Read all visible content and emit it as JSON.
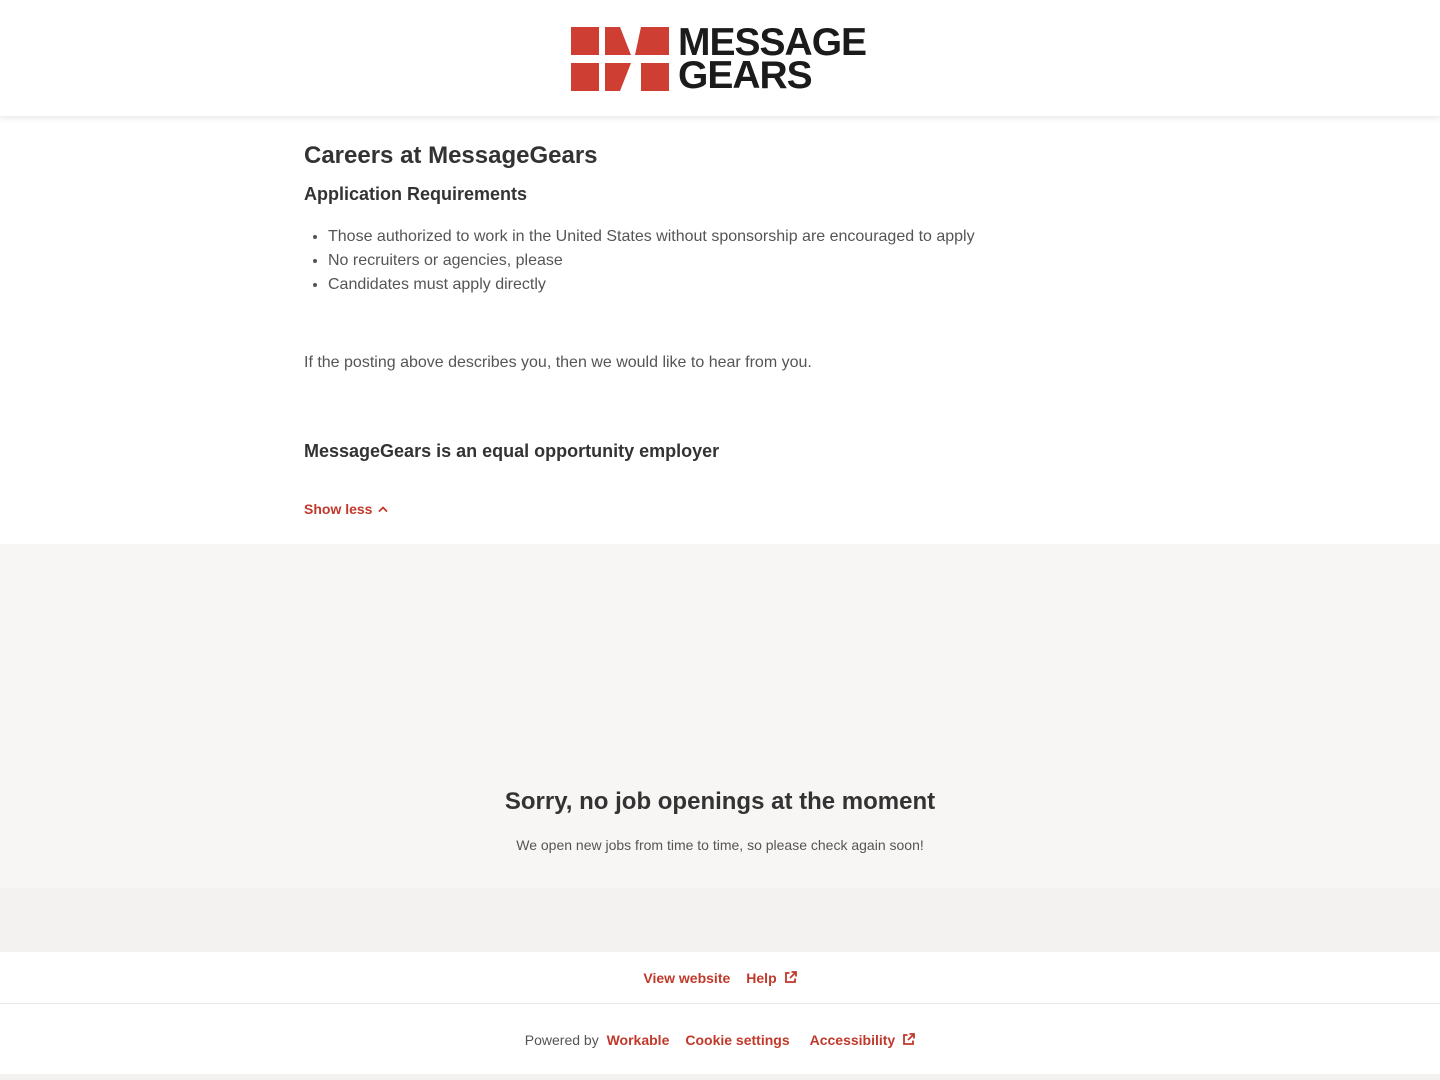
{
  "header": {
    "logo_line1": "MESSAGE",
    "logo_line2": "GEARS",
    "logo_color": "#cf3e32"
  },
  "main": {
    "title": "Careers at MessageGears",
    "requirements_heading": "Application Requirements",
    "requirements": [
      "Those authorized to work in the United States without sponsorship are encouraged to apply",
      "No recruiters or agencies, please",
      "Candidates must apply directly"
    ],
    "closing_text": "If the posting above describes you, then we would like to hear from you.",
    "eeo_heading": "MessageGears is an equal opportunity employer",
    "show_less_label": "Show less",
    "show_less_icon": "chevron-up-icon"
  },
  "jobs": {
    "empty_title": "Sorry, no job openings at the moment",
    "empty_text": "We open new jobs from time to time, so please check again soon!"
  },
  "footer": {
    "view_website_label": "View website",
    "help_label": "Help",
    "help_icon": "external-link-icon",
    "powered_by_prefix": "Powered by",
    "workable_label": "Workable",
    "cookie_settings_label": "Cookie settings",
    "accessibility_label": "Accessibility",
    "accessibility_icon": "external-link-icon"
  },
  "colors": {
    "accent": "#c0392b",
    "jobs_background": "#f7f6f4",
    "heading_text": "#333333",
    "body_text": "#555555"
  }
}
